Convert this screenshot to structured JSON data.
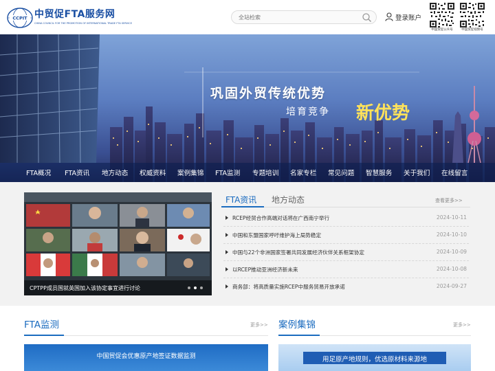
{
  "header": {
    "logo_title": "中贸促FTA服务网",
    "logo_subtitle": "CHINA COUNCIL FOR THE PROMOTION OF INTERNATIONAL TRADE FTA SERVICE",
    "logo_emblem_text": "CCPIT",
    "search_placeholder": "全站检索",
    "login_label": "登录账户",
    "qr_codes": [
      {
        "caption": "中国贸促公众号"
      },
      {
        "caption": "中国贸促视频号"
      }
    ]
  },
  "banner": {
    "slogan_line1": "巩固外贸传统优势",
    "slogan_line2": "培育竞争",
    "slogan_line3": "新优势"
  },
  "nav": {
    "items": [
      "FTA概况",
      "FTA资讯",
      "地方动态",
      "权威资料",
      "案例集锦",
      "FTA监测",
      "专题培训",
      "名家专栏",
      "常见问题",
      "智慧服务",
      "关于我们",
      "在线留言"
    ]
  },
  "news": {
    "carousel_caption": "CPTPP成员国就英国加入该协定事宜进行讨论",
    "carousel_slide_count": 3,
    "carousel_active_slide": 2,
    "tab_active": "FTA资讯",
    "tab_inactive": "地方动态",
    "more_label": "查看更多>>",
    "items": [
      {
        "title": "RCEP经贸合作高端对话将在广西南宁举行",
        "date": "2024-10-11"
      },
      {
        "title": "中国和东盟国家呼吁维护海上局势稳定",
        "date": "2024-10-10"
      },
      {
        "title": "中国与22个非洲国家签署共同发展经济伙伴关系框架协定",
        "date": "2024-10-09"
      },
      {
        "title": "以RCEP推动亚洲经济新未来",
        "date": "2024-10-08"
      },
      {
        "title": "商务部：将高质量实施RCEP中服务贸易开放承诺",
        "date": "2024-09-27"
      }
    ]
  },
  "sections": {
    "monitor": {
      "title": "FTA监测",
      "more": "更多>>",
      "image_caption": "中国贸促会优惠原产地签证数据监测"
    },
    "cases": {
      "title": "案例集锦",
      "more": "更多>>",
      "image_caption": "用足原产地规则，优选原材料来源地"
    }
  },
  "colors": {
    "brand_blue": "#1a4fa3",
    "accent_blue": "#1a6bbf",
    "slogan_yellow": "#ffe25a"
  }
}
